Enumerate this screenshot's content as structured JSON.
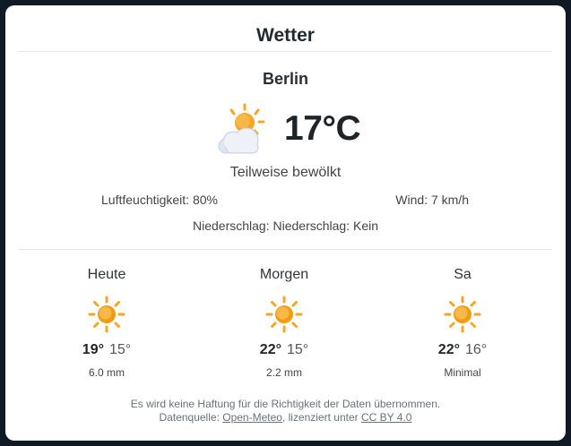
{
  "widget": {
    "title": "Wetter",
    "city": "Berlin",
    "current": {
      "icon": "partly-cloudy-icon",
      "temperature": "17°C",
      "condition": "Teilweise bewölkt",
      "humidity": "Luftfeuchtigkeit: 80%",
      "wind": "Wind: 7 km/h",
      "precipitation": "Niederschlag: Niederschlag: Kein"
    },
    "forecast": [
      {
        "day": "Heute",
        "icon": "sun-icon",
        "max": "19°",
        "min": "15°",
        "rain": "6.0 mm"
      },
      {
        "day": "Morgen",
        "icon": "sun-icon",
        "max": "22°",
        "min": "15°",
        "rain": "2.2 mm"
      },
      {
        "day": "Sa",
        "icon": "sun-icon",
        "max": "22°",
        "min": "16°",
        "rain": "Minimal"
      }
    ],
    "footer": {
      "disclaimer": "Es wird keine Haftung für die Richtigkeit der Daten übernommen.",
      "source_prefix": "Datenquelle:",
      "source_link": "Open-Meteo",
      "license_prefix": ", lizenziert unter",
      "license_link": "CC BY 4.0"
    },
    "colors": {
      "sun": "#f5a623",
      "sun_center": "#f39c12",
      "cloud": "#dfe6f2"
    }
  }
}
